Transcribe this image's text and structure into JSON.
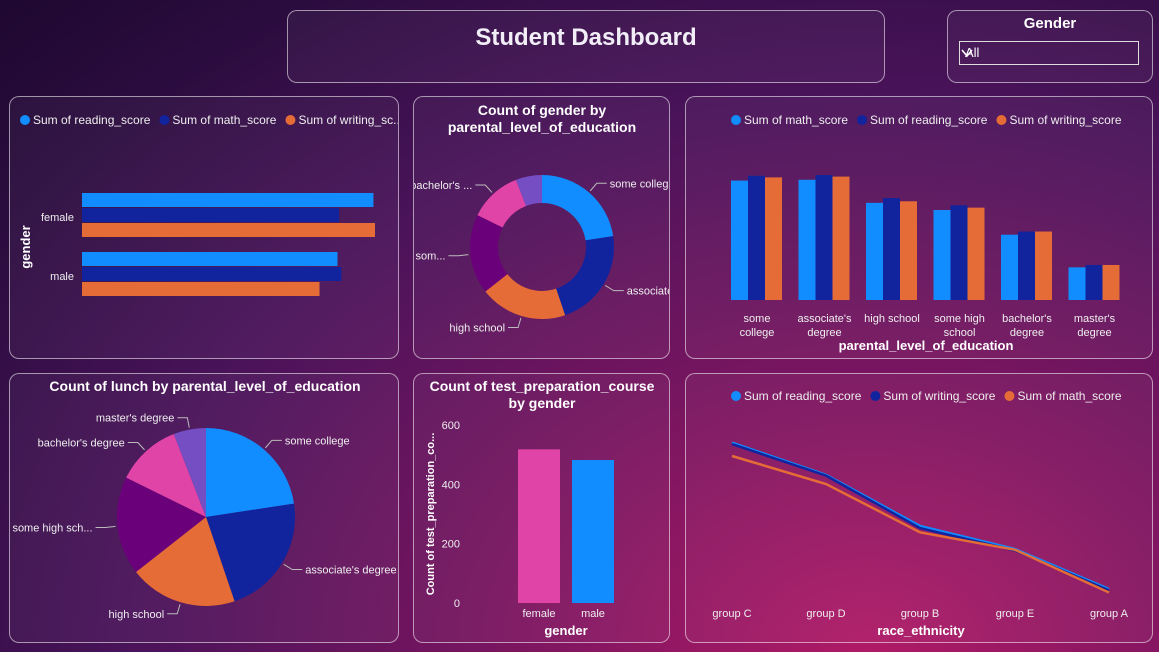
{
  "header": {
    "title": "Student Dashboard"
  },
  "slicer": {
    "label": "Gender",
    "value": "All"
  },
  "colors": {
    "blue": "#118dff",
    "navy": "#12239e",
    "orange": "#e66c37",
    "purple": "#6b007b",
    "pink": "#e044a7",
    "lavender": "#744ec2"
  },
  "chart_data": [
    {
      "id": "gender_scores",
      "type": "bar",
      "orientation": "horizontal",
      "categories": [
        "female",
        "male"
      ],
      "ylabel": "gender",
      "legend_position": "top-left",
      "series": [
        {
          "name": "Sum of reading_score",
          "legend": "Sum of reading_score",
          "values": [
            37300,
            32700
          ]
        },
        {
          "name": "Sum of math_score",
          "legend": "Sum of math_score",
          "values": [
            32900,
            33200
          ]
        },
        {
          "name": "Sum of writing_score",
          "legend": "Sum of writing_sc...",
          "values": [
            37500,
            30400
          ]
        }
      ]
    },
    {
      "id": "gender_by_edu",
      "type": "pie",
      "variant": "donut",
      "title_line1": "Count of gender by",
      "title_line2": "parental_level_of_education",
      "slices": [
        {
          "name": "some college",
          "label": "some college",
          "value": 226
        },
        {
          "name": "associate's degree",
          "label": "associate'...",
          "value": 222
        },
        {
          "name": "high school",
          "label": "high school",
          "value": 196
        },
        {
          "name": "some high school",
          "label": "som...",
          "value": 179
        },
        {
          "name": "bachelor's degree",
          "label": "bachelor's ...",
          "value": 118
        },
        {
          "name": "master's degree",
          "label": "",
          "value": 59
        }
      ]
    },
    {
      "id": "edu_scores",
      "type": "bar",
      "orientation": "vertical",
      "categories": [
        [
          "some",
          "college"
        ],
        [
          "associate's",
          "degree"
        ],
        [
          "high school"
        ],
        [
          "some high",
          "school"
        ],
        [
          "bachelor's",
          "degree"
        ],
        [
          "master's",
          "degree"
        ]
      ],
      "xlabel": "parental_level_of_education",
      "legend_position": "top",
      "series": [
        {
          "name": "Sum of math_score",
          "values": [
            15000,
            15100,
            12200,
            11300,
            8200,
            4100
          ]
        },
        {
          "name": "Sum of reading_score",
          "values": [
            15600,
            15700,
            12800,
            11900,
            8600,
            4400
          ]
        },
        {
          "name": "Sum of writing_score",
          "values": [
            15400,
            15500,
            12400,
            11600,
            8600,
            4400
          ]
        }
      ]
    },
    {
      "id": "lunch_by_edu",
      "type": "pie",
      "title": "Count of lunch by parental_level_of_education",
      "slices": [
        {
          "name": "some college",
          "label": "some college",
          "value": 226
        },
        {
          "name": "associate's degree",
          "label": "associate's degree",
          "value": 222
        },
        {
          "name": "high school",
          "label": "high school",
          "value": 196
        },
        {
          "name": "some high school",
          "label": "some high sch...",
          "value": 179
        },
        {
          "name": "bachelor's degree",
          "label": "bachelor's degree",
          "value": 118
        },
        {
          "name": "master's degree",
          "label": "master's degree",
          "value": 59
        }
      ]
    },
    {
      "id": "test_prep_by_gender",
      "type": "bar",
      "orientation": "vertical",
      "title_line1": "Count of test_preparation_course",
      "title_line2": "by gender",
      "categories": [
        "female",
        "male"
      ],
      "values": [
        518,
        482
      ],
      "xlabel": "gender",
      "ylabel": "Count of test_preparation_co...",
      "ylim": [
        0,
        600
      ],
      "yticks": [
        "0",
        "200",
        "400",
        "600"
      ]
    },
    {
      "id": "race_scores",
      "type": "line",
      "categories": [
        "group C",
        "group D",
        "group B",
        "group E",
        "group A"
      ],
      "xlabel": "race_ethnicity",
      "legend_position": "top",
      "series": [
        {
          "name": "Sum of reading_score",
          "values": [
            22900,
            18300,
            11000,
            7700,
            2000
          ]
        },
        {
          "name": "Sum of writing_score",
          "values": [
            22700,
            18200,
            10700,
            7500,
            1800
          ]
        },
        {
          "name": "Sum of math_score",
          "values": [
            21000,
            17000,
            10100,
            7600,
            1500
          ]
        }
      ],
      "ylim": [
        0,
        24000
      ]
    }
  ]
}
